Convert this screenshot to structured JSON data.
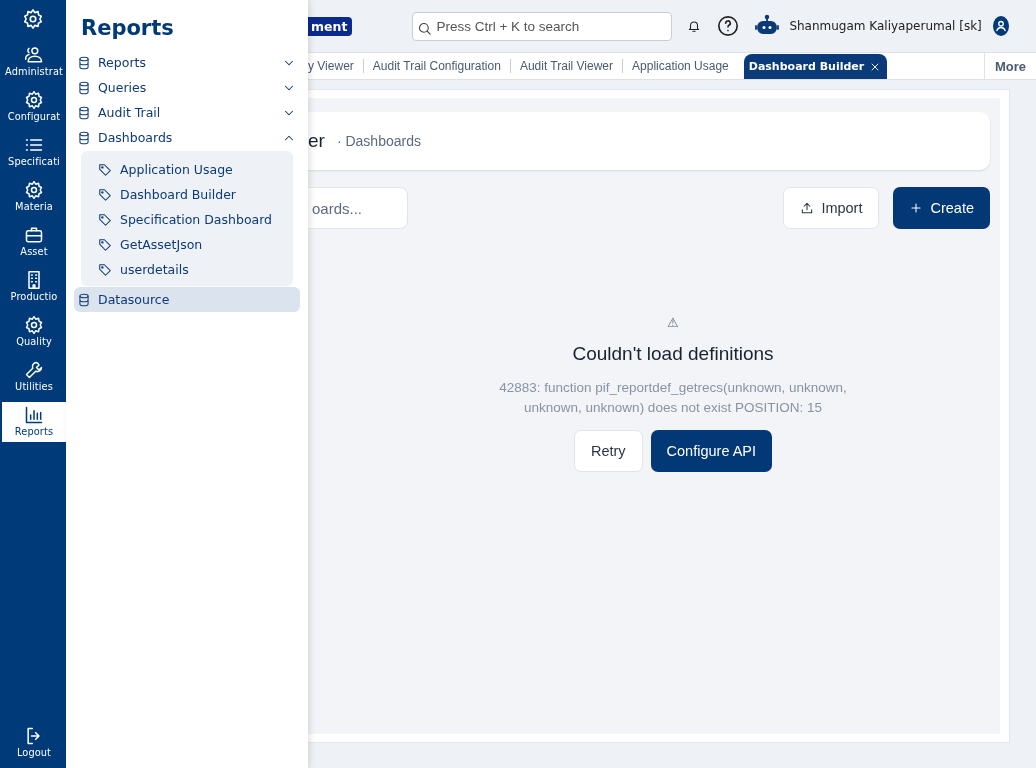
{
  "rail": {
    "items": [
      {
        "label": "Administrat",
        "selected": false
      },
      {
        "label": "Configurat",
        "selected": false
      },
      {
        "label": "Specificati",
        "selected": false
      },
      {
        "label": "Materia",
        "selected": false
      },
      {
        "label": "Asset",
        "selected": false
      },
      {
        "label": "Productio",
        "selected": false
      },
      {
        "label": "Quality",
        "selected": false
      },
      {
        "label": "Utilities",
        "selected": false
      },
      {
        "label": "Reports",
        "selected": true
      }
    ],
    "logout": "Logout"
  },
  "flyout": {
    "title": "Reports",
    "items": [
      {
        "label": "Reports",
        "expanded": false,
        "selected": false
      },
      {
        "label": "Queries",
        "expanded": false,
        "selected": false
      },
      {
        "label": "Audit Trail",
        "expanded": false,
        "selected": false
      },
      {
        "label": "Dashboards",
        "expanded": true,
        "selected": false,
        "children": [
          {
            "label": "Application Usage"
          },
          {
            "label": "Dashboard Builder"
          },
          {
            "label": "Specification Dashboard"
          },
          {
            "label": "GetAssetJson"
          },
          {
            "label": "userdetails"
          }
        ]
      },
      {
        "label": "Datasource",
        "selected": true
      }
    ]
  },
  "header": {
    "badge": "ment",
    "search": {
      "placeholder": "Press Ctrl + K to search"
    },
    "user": "Shanmugam Kaliyaperumal [sk]"
  },
  "tabs": [
    {
      "label": "y Viewer",
      "selected": false
    },
    {
      "label": "Audit Trail Configuration",
      "selected": false
    },
    {
      "label": "Audit Trail Viewer",
      "selected": false
    },
    {
      "label": "Application Usage",
      "selected": false
    },
    {
      "label": "Dashboard Builder",
      "selected": true
    }
  ],
  "more": "More",
  "page": {
    "title": "er",
    "breadcrumb": "· Dashboards",
    "search": {
      "placeholder": "oards..."
    },
    "buttons": [
      "Import",
      "Create"
    ]
  },
  "error": {
    "icon": "⚠",
    "title": "Couldn't load definitions",
    "message": "42883: function pif_reportdef_getrecs(unknown, unknown, unknown, unknown) does not exist POSITION: 15",
    "buttons": [
      "Retry",
      "Configure API"
    ]
  }
}
